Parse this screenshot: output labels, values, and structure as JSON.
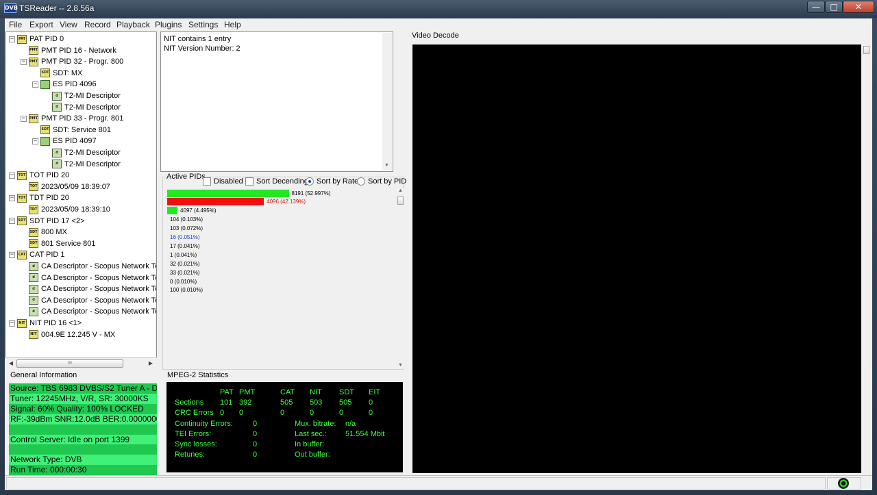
{
  "window": {
    "title": "TSReader -- 2.8.56a",
    "icon_text": "DVB"
  },
  "menu": [
    "File",
    "Export",
    "View",
    "Record",
    "Playback",
    "Plugins",
    "Settings",
    "Help"
  ],
  "tree": [
    {
      "depth": 0,
      "exp": "−",
      "icon": "PAT",
      "label": "PAT PID 0"
    },
    {
      "depth": 1,
      "exp": "",
      "icon": "PMT",
      "label": "PMT PID 16 - Network"
    },
    {
      "depth": 1,
      "exp": "−",
      "icon": "PMT",
      "label": "PMT PID 32 - Progr. 800"
    },
    {
      "depth": 2,
      "exp": "",
      "icon": "SDT",
      "label": "SDT: MX"
    },
    {
      "depth": 2,
      "exp": "−",
      "icon": "ES",
      "label": "ES PID 4096"
    },
    {
      "depth": 3,
      "exp": "",
      "icon": "d",
      "label": "T2-MI Descriptor"
    },
    {
      "depth": 3,
      "exp": "",
      "icon": "d",
      "label": "T2-MI Descriptor"
    },
    {
      "depth": 1,
      "exp": "−",
      "icon": "PMT",
      "label": "PMT PID 33 - Progr. 801"
    },
    {
      "depth": 2,
      "exp": "",
      "icon": "SDT",
      "label": "SDT: Service 801"
    },
    {
      "depth": 2,
      "exp": "−",
      "icon": "ES",
      "label": "ES PID 4097"
    },
    {
      "depth": 3,
      "exp": "",
      "icon": "d",
      "label": "T2-MI Descriptor"
    },
    {
      "depth": 3,
      "exp": "",
      "icon": "d",
      "label": "T2-MI Descriptor"
    },
    {
      "depth": 0,
      "exp": "−",
      "icon": "TOT",
      "label": "TOT PID 20"
    },
    {
      "depth": 1,
      "exp": "",
      "icon": "TOT",
      "label": "2023/05/09 18:39:07"
    },
    {
      "depth": 0,
      "exp": "−",
      "icon": "TDT",
      "label": "TDT PID 20"
    },
    {
      "depth": 1,
      "exp": "",
      "icon": "TDT",
      "label": "2023/05/09 18:39:10"
    },
    {
      "depth": 0,
      "exp": "−",
      "icon": "SDT",
      "label": "SDT PID 17 <2>"
    },
    {
      "depth": 1,
      "exp": "",
      "icon": "SDT",
      "label": "800 MX"
    },
    {
      "depth": 1,
      "exp": "",
      "icon": "SDT",
      "label": "801 Service 801"
    },
    {
      "depth": 0,
      "exp": "−",
      "icon": "CAT",
      "label": "CAT PID 1"
    },
    {
      "depth": 1,
      "exp": "",
      "icon": "d",
      "label": "CA Descriptor - Scopus Network Te"
    },
    {
      "depth": 1,
      "exp": "",
      "icon": "d",
      "label": "CA Descriptor - Scopus Network Te"
    },
    {
      "depth": 1,
      "exp": "",
      "icon": "d",
      "label": "CA Descriptor - Scopus Network Te"
    },
    {
      "depth": 1,
      "exp": "",
      "icon": "d",
      "label": "CA Descriptor - Scopus Network Te"
    },
    {
      "depth": 1,
      "exp": "",
      "icon": "d",
      "label": "CA Descriptor - Scopus Network Te"
    },
    {
      "depth": 0,
      "exp": "−",
      "icon": "NIT",
      "label": "NIT PID 16 <1>"
    },
    {
      "depth": 1,
      "exp": "",
      "icon": "NIT",
      "label": "004.9E 12.245 V - MX"
    }
  ],
  "nit": {
    "line1": "NIT contains 1 entry",
    "line2": "NIT Version Number: 2"
  },
  "active_pids": {
    "label": "Active PIDs",
    "options": {
      "disabled": "Disabled",
      "sort_desc": "Sort Decending",
      "sort_rate": "Sort by Rate",
      "sort_pid": "Sort by PID"
    },
    "selected": "sort_rate",
    "rows": [
      {
        "text": "8191 (52.997%)",
        "pct": 52.997,
        "bar": "#22e822",
        "color": "#000"
      },
      {
        "text": "4096 (42.139%)",
        "pct": 42.139,
        "bar": "#f01010",
        "color": "#e01010"
      },
      {
        "text": "4097 (4.495%)",
        "pct": 4.495,
        "bar": "#22e822",
        "color": "#000"
      },
      {
        "text": "104 (0.103%)",
        "pct": 0,
        "bar": "",
        "color": "#000"
      },
      {
        "text": "103 (0.072%)",
        "pct": 0,
        "bar": "",
        "color": "#000"
      },
      {
        "text": "16 (0.051%)",
        "pct": 0,
        "bar": "",
        "color": "#1a3cd0"
      },
      {
        "text": "17 (0.041%)",
        "pct": 0,
        "bar": "",
        "color": "#000"
      },
      {
        "text": "1 (0.041%)",
        "pct": 0,
        "bar": "",
        "color": "#000"
      },
      {
        "text": "32 (0.021%)",
        "pct": 0,
        "bar": "",
        "color": "#000"
      },
      {
        "text": "33 (0.021%)",
        "pct": 0,
        "bar": "",
        "color": "#000"
      },
      {
        "text": "0 (0.010%)",
        "pct": 0,
        "bar": "",
        "color": "#000"
      },
      {
        "text": "100 (0.010%)",
        "pct": 0,
        "bar": "",
        "color": "#000"
      }
    ]
  },
  "video": {
    "label": "Video Decode"
  },
  "general": {
    "label": "General Information",
    "rows": [
      {
        "text": "Source: TBS 6983 DVBS/S2 Tuner A - D",
        "bg": "#20c850"
      },
      {
        "text": "Tuner: 12245MHz, V/R, SR: 30000KS",
        "bg": "#40f078"
      },
      {
        "text": "Signal: 60% Quality: 100% LOCKED",
        "bg": "#20c850"
      },
      {
        "text": "RF:-39dBm SNR:12.0dB BER:0.0000000",
        "bg": "#40f078"
      },
      {
        "text": "",
        "bg": "#20c850"
      },
      {
        "text": "Control Server: Idle on port 1399",
        "bg": "#40f078"
      },
      {
        "text": "",
        "bg": "#20c850"
      },
      {
        "text": "Network Type: DVB",
        "bg": "#40f078"
      },
      {
        "text": "Run Time: 000:00:30",
        "bg": "#20c850"
      }
    ]
  },
  "mpeg": {
    "label": "MPEG-2 Statistics",
    "headers": [
      "PAT",
      "PMT",
      "CAT",
      "NIT",
      "SDT",
      "EIT"
    ],
    "sections_label": "Sections",
    "sections": [
      "101",
      "392",
      "505",
      "503",
      "505",
      "0"
    ],
    "crc_label": "CRC Errors",
    "crc": [
      "0",
      "0",
      "0",
      "0",
      "0",
      "0"
    ],
    "left": [
      {
        "k": "Continuity Errors:",
        "v": "0"
      },
      {
        "k": "TEI Errors:",
        "v": "0"
      },
      {
        "k": "Sync losses:",
        "v": "0"
      },
      {
        "k": "Retunes:",
        "v": "0"
      }
    ],
    "right": [
      {
        "k": "Mux. bitrate:",
        "v": "n/a"
      },
      {
        "k": "Last sec.:",
        "v": "51.554 Mbit"
      },
      {
        "k": "In buffer:",
        "v": ""
      },
      {
        "k": "Out buffer:",
        "v": ""
      }
    ]
  },
  "colors": {
    "green_bar": "#22e822",
    "red_bar": "#f01010",
    "stats_text": "#3cff3c"
  }
}
